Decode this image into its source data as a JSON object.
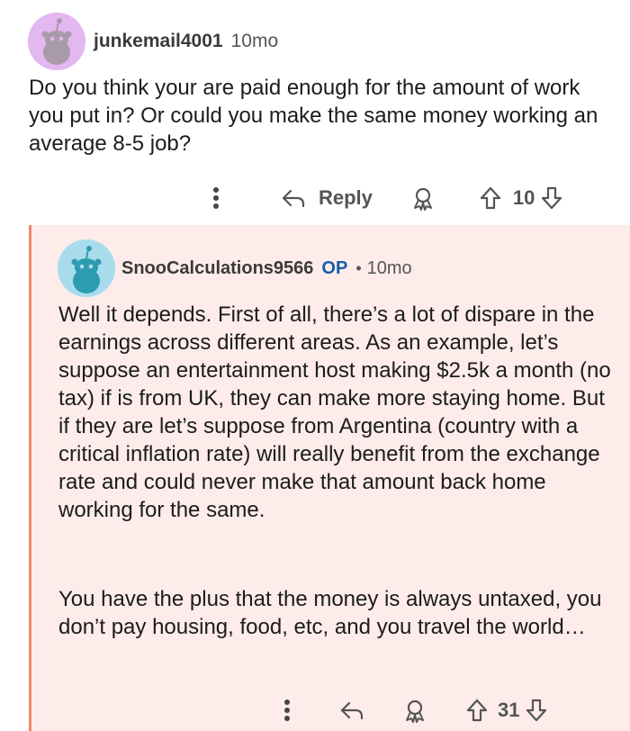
{
  "comment": {
    "username": "junkemail4001",
    "age": "10mo",
    "body": "Do you think your are paid enough for the amount of work you put in? Or could you make the same money working an average 8-5 job?",
    "actions": {
      "more_icon": "more-vertical-icon",
      "reply_label": "Reply",
      "award_icon": "award-icon",
      "vote_count": "10"
    }
  },
  "reply": {
    "username": "SnooCalculations9566",
    "op_badge": "OP",
    "separator": "•",
    "age": "10mo",
    "paragraphs": [
      "Well it depends. First of all, there’s a lot of dispare in the earnings across different areas. As an example, let’s suppose an entertainment host making $2.5k a month (no tax) if is from UK, they can make more staying home. But if they are let’s suppose from Argentina (country with a critical inflation rate) will really benefit from the exchange rate and could never make that amount back home working for the same.",
      "You have the plus that the money is always untaxed, you don’t pay housing, food, etc, and you travel the world…"
    ],
    "actions": {
      "more_icon": "more-vertical-icon",
      "reply_icon": "reply-icon",
      "award_icon": "award-icon",
      "vote_count": "31"
    }
  },
  "colors": {
    "accent_op": "#1a5ca8",
    "thread_line": "#f08a6c",
    "highlight_bg": "#fdecea",
    "avatar1_bg": "#e3b7f0",
    "avatar2_bg": "#a8dcec"
  }
}
